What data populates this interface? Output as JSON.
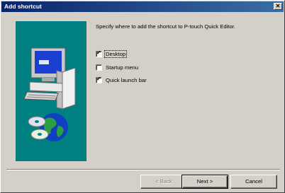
{
  "window": {
    "title": "Add shortcut",
    "close_glyph": "✕"
  },
  "instruction": "Specify where to add the shortcut to P-touch Quick Editor.",
  "options": [
    {
      "label": "Desktop",
      "checked": true
    },
    {
      "label": "Startup menu",
      "checked": false
    },
    {
      "label": "Quick launch bar",
      "checked": true
    }
  ],
  "buttons": {
    "back": "< Back",
    "next": "Next >",
    "cancel": "Cancel"
  },
  "colors": {
    "titlebar": "#0a246a",
    "art_bg": "#008080",
    "face": "#d4d0c8"
  },
  "icons": {
    "art": "computer-with-globe-and-cds"
  }
}
